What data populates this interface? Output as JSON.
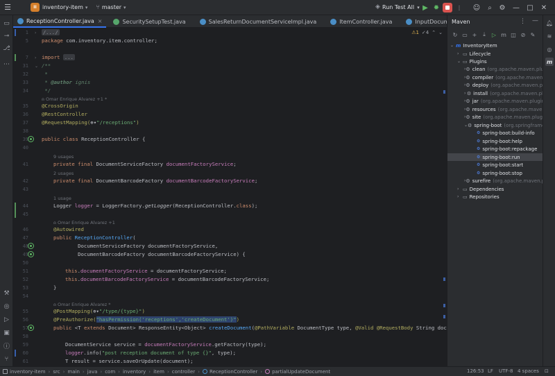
{
  "titlebar": {
    "project_badge": "II",
    "project_name": "inventory-item",
    "branch": "master",
    "run_config": "Run Test All"
  },
  "tabs": [
    {
      "label": "ReceptionController.java",
      "active": true,
      "kind": "class"
    },
    {
      "label": "SecuritySetupTest.java",
      "active": false,
      "kind": "test"
    },
    {
      "label": "SalesReturnDocumentServiceImpl.java",
      "active": false,
      "kind": "class"
    },
    {
      "label": "ItemController.java",
      "active": false,
      "kind": "class"
    },
    {
      "label": "InputDocumentServiceImpl.java",
      "active": false,
      "kind": "class"
    }
  ],
  "editor": {
    "indicator_warn": "⚠1",
    "indicator_checks": "✓4"
  },
  "code": {
    "l1": "/.../",
    "l5_kw": "package",
    "l5_rest": " com.inventory.item.controller;",
    "l7_kw": "import",
    "l7_collapsed": "...",
    "l31": "/**",
    "l32": " *",
    "l33_pre": " * ",
    "l33_tag": "@author",
    "l33_rest": " ignis",
    "l34": " */",
    "h_author1": "Omar Enrique Alvarez +1 *",
    "l35": "@CrossOrigin",
    "l36": "@RestController",
    "l37_ann": "@RequestMapping(",
    "l37_icon": "⊕▾",
    "l37_str": "\"/receptions\"",
    "l37_end": ")",
    "l39_kw": "public class",
    "l39_rest": " ReceptionController {",
    "h_usages9": "9 usages",
    "l41_kw": "private final",
    "l41_type": " DocumentServiceFactory ",
    "l41_fld": "documentFactoryService",
    "l41_end": ";",
    "h_usages2": "2 usages",
    "l42_kw": "private final",
    "l42_type": " DocumentBarcodeFactory ",
    "l42_fld": "documentBarcodeFactoryService",
    "l42_end": ";",
    "h_usage1": "1 usage",
    "l44_a": "Logger ",
    "l44_fld": "logger",
    "l44_b": " = LoggerFactory.",
    "l44_it": "getLogger",
    "l44_c": "(ReceptionController.",
    "l44_kw": "class",
    "l44_d": ");",
    "h_author2": "Omar Enrique Alvarez +1",
    "l46": "@Autowired",
    "l47_kw": "public",
    "l47_mth": " ReceptionController",
    "l47_end": "(",
    "l48": "        DocumentServiceFactory documentFactoryService,",
    "l49": "        DocumentBarcodeFactory documentBarcodeFactoryService) {",
    "l51_kw": "this",
    "l51_dot": ".",
    "l51_fld": "documentFactoryService",
    "l51_rest": " = documentFactoryService;",
    "l52_kw": "this",
    "l52_dot": ".",
    "l52_fld": "documentBarcodeFactoryService",
    "l52_rest": " = documentBarcodeFactoryService;",
    "l53": "}",
    "h_author3": "Omar Enrique Alvarez *",
    "l55_ann": "@PostMapping(",
    "l55_icon": "⊕▾",
    "l55_str": "\"/type/{type}\"",
    "l55_end": ")",
    "l56_ann": "@PreAuthorize(",
    "l56_str": "\"hasPermission('receptions','createDocument')\"",
    "l56_end": ")",
    "l57_kw1": "public",
    "l57_a": " <T ",
    "l57_kw2": "extends",
    "l57_b": " Document> ResponseEntity<Object> ",
    "l57_mth": "createDocument",
    "l57_c": "(",
    "l57_ann1": "@PathVariable",
    "l57_d": " DocumentType type, ",
    "l57_ann2": "@Valid @RequestBody",
    "l57_e": " String document",
    "l59_a": "DocumentService service = ",
    "l59_fld": "documentFactoryService",
    "l59_b": ".getFactory(type);",
    "l60_fld": "logger",
    "l60_a": ".info(",
    "l60_str": "\"post reception document of type {}\"",
    "l60_b": ", type);",
    "l61_a": "T result = service.saveOrUpdate(document);"
  },
  "maven": {
    "title": "Maven",
    "tree": [
      {
        "label": "InventoryItem",
        "grey": ""
      },
      {
        "label": "Lifecycle",
        "grey": ""
      },
      {
        "label": "Plugins",
        "grey": ""
      },
      {
        "label": "clean",
        "grey": "(org.apache.maven.plugins"
      },
      {
        "label": "compiler",
        "grey": "(org.apache.maven."
      },
      {
        "label": "deploy",
        "grey": "(org.apache.maven.pl"
      },
      {
        "label": "install",
        "grey": "(org.apache.maven.pl"
      },
      {
        "label": "jar",
        "grey": "(org.apache.maven.plugin"
      },
      {
        "label": "resources",
        "grey": "(org.apache.maven.p"
      },
      {
        "label": "site",
        "grey": "(org.apache.maven.plugin"
      },
      {
        "label": "spring-boot",
        "grey": "(org.springframe"
      },
      {
        "label": "spring-boot:build-info",
        "grey": ""
      },
      {
        "label": "spring-boot:help",
        "grey": ""
      },
      {
        "label": "spring-boot:repackage",
        "grey": ""
      },
      {
        "label": "spring-boot:run",
        "grey": ""
      },
      {
        "label": "spring-boot:start",
        "grey": ""
      },
      {
        "label": "spring-boot:stop",
        "grey": ""
      },
      {
        "label": "surefire",
        "grey": "(org.apache.maven.p"
      },
      {
        "label": "Dependencies",
        "grey": ""
      },
      {
        "label": "Repositories",
        "grey": ""
      }
    ]
  },
  "statusbar": {
    "crumbs": [
      "inventory-item",
      "src",
      "main",
      "java",
      "com",
      "inventory",
      "item",
      "controller",
      "ReceptionController",
      "partialUpdateDocument"
    ],
    "position": "126:53",
    "line_sep": "LF",
    "encoding": "UTF-8",
    "indent": "4 spaces"
  },
  "colors": {
    "accent": "#3574f0",
    "run_green": "#5fb865",
    "stop_red": "#d9534f",
    "project_badge": "#d57f2b"
  }
}
